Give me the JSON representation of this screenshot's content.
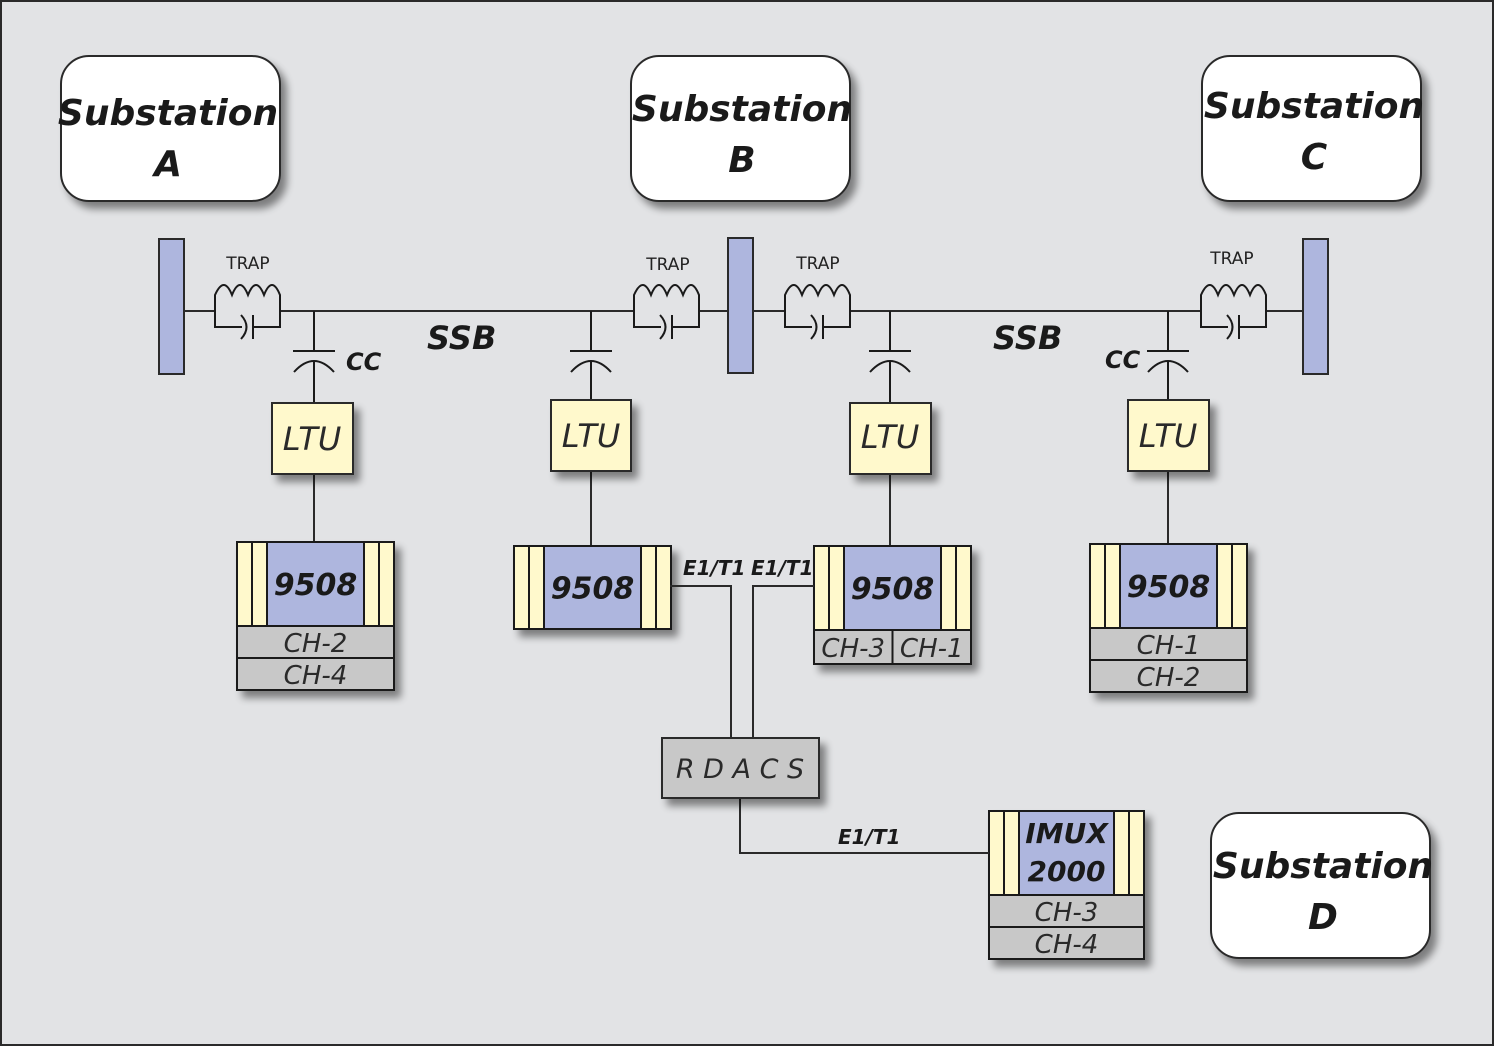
{
  "colors": {
    "background": "#e2e3e5",
    "bus": "#aeb6de",
    "ltu": "#fff9cc",
    "mux_core": "#aeb6de",
    "mux_side": "#fff9cc",
    "channel": "#c8c8c8",
    "rdacs": "#c8c8c8",
    "line": "#1a1a1a",
    "substation_fill": "#ffffff"
  },
  "substations": [
    {
      "line1": "Substation",
      "line2": "A"
    },
    {
      "line1": "Substation",
      "line2": "B"
    },
    {
      "line1": "Substation",
      "line2": "C"
    },
    {
      "line1": "Substation",
      "line2": "D"
    }
  ],
  "traps": [
    "TRAP",
    "TRAP",
    "TRAP",
    "TRAP"
  ],
  "cc_labels": [
    "CC",
    "CC"
  ],
  "ssb_labels": [
    "SSB",
    "SSB"
  ],
  "ltus": [
    "LTU",
    "LTU",
    "LTU",
    "LTU"
  ],
  "muxes": [
    {
      "label": "9508",
      "channels": [
        "CH-2",
        "CH-4"
      ]
    },
    {
      "label": "9508",
      "channels": []
    },
    {
      "label": "9508",
      "channels": [
        "CH-3",
        "CH-1"
      ]
    },
    {
      "label": "9508",
      "channels": [
        "CH-1",
        "CH-2"
      ]
    }
  ],
  "imux": {
    "line1": "IMUX",
    "line2": "2000",
    "channels": [
      "CH-3",
      "CH-4"
    ]
  },
  "rdacs": "R D A C S",
  "links": {
    "e1t1_left": "E1/T1",
    "e1t1_right": "E1/T1",
    "e1t1_bottom": "E1/T1"
  }
}
